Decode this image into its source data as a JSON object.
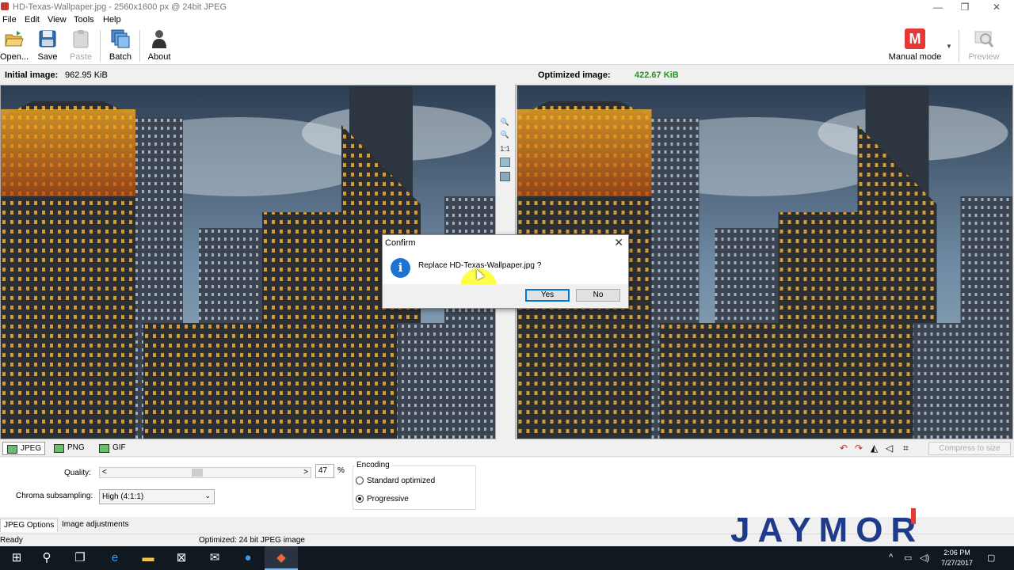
{
  "window": {
    "title": "HD-Texas-Wallpaper.jpg - 2560x1600 px @ 24bit JPEG",
    "minimize": "—",
    "maximize": "❐",
    "close": "✕"
  },
  "menu": [
    "File",
    "Edit",
    "View",
    "Tools",
    "Help"
  ],
  "toolbar": {
    "open": "Open...",
    "save": "Save",
    "paste": "Paste",
    "batch": "Batch",
    "about": "About",
    "mode_letter": "M",
    "mode": "Manual mode",
    "preview": "Preview"
  },
  "info": {
    "initial_label": "Initial image:",
    "initial_size": "962.95 KiB",
    "optimized_label": "Optimized image:",
    "optimized_size": "422.67 KiB"
  },
  "zoom_strip": {
    "one_to_one": "1:1"
  },
  "dialog": {
    "title": "Confirm",
    "close": "✕",
    "icon": "i",
    "message": "Replace HD-Texas-Wallpaper.jpg ?",
    "yes": "Yes",
    "no": "No"
  },
  "formats": [
    "JPEG",
    "PNG",
    "GIF"
  ],
  "compress_button": "Compress to size",
  "options": {
    "quality_label": "Quality:",
    "quality_value": "47",
    "quality_fraction": 0.47,
    "slider_left": "<",
    "slider_right": ">",
    "quality_unit": "%",
    "chroma_label": "Chroma subsampling:",
    "chroma_value": "High (4:1:1)",
    "encoding_label": "Encoding",
    "encoding_standard": "Standard optimized",
    "encoding_progressive": "Progressive"
  },
  "bottom_tabs": [
    "JPEG Options",
    "Image adjustments"
  ],
  "status": {
    "left": "Ready",
    "middle": "Optimized: 24 bit JPEG image"
  },
  "logo": {
    "text": "JAYMOR",
    "color": "#1e3a8a",
    "accent": "#e53935"
  },
  "taskbar": {
    "time": "2:06 PM",
    "date": "7/27/2017"
  },
  "colors": {
    "accent_red": "#e53935",
    "size_green": "#1a9a1a",
    "taskbar": "#101820"
  }
}
